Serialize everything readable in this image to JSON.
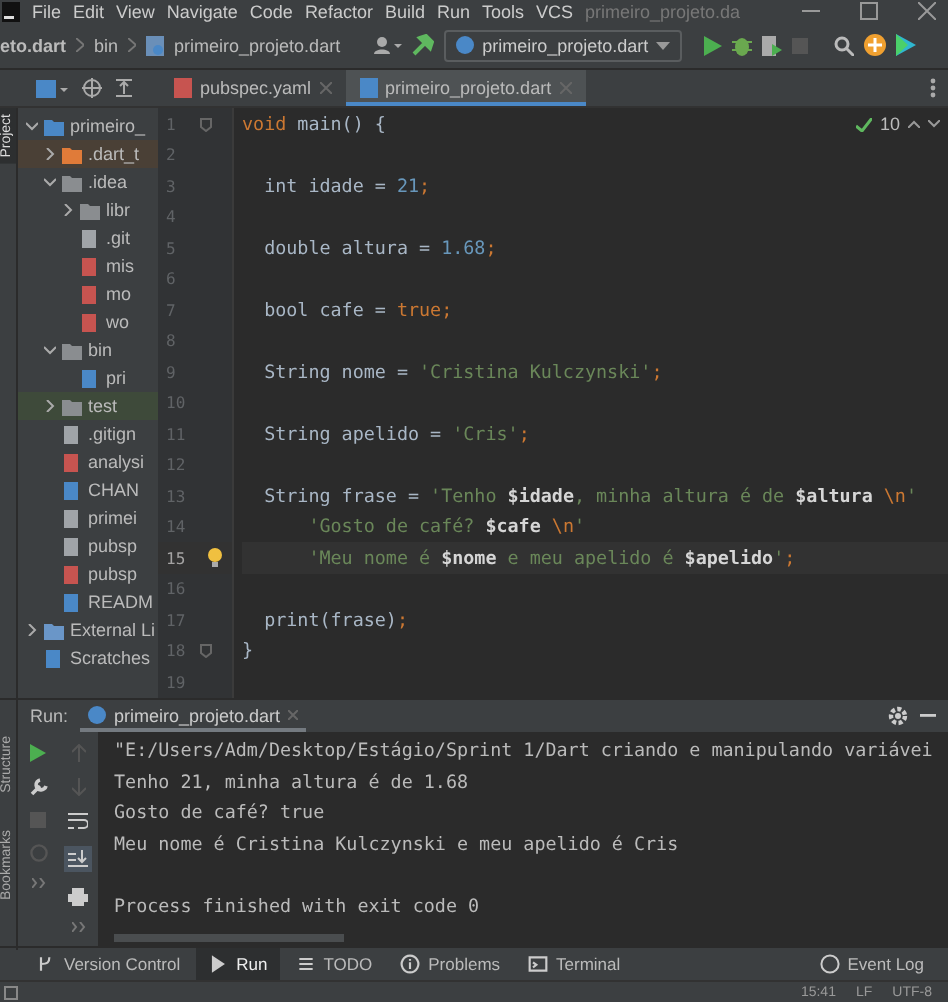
{
  "menu_bar": {
    "items": [
      "File",
      "Edit",
      "View",
      "Navigate",
      "Code",
      "Refactor",
      "Build",
      "Run",
      "Tools",
      "VCS"
    ],
    "title": "primeiro_projeto.da"
  },
  "nav_bar": {
    "breadcrumbs": [
      "eto.dart",
      "bin",
      "primeiro_projeto.dart"
    ],
    "run_config": "primeiro_projeto.dart"
  },
  "editor_tabs": [
    {
      "label": "pubspec.yaml",
      "kind": "yaml",
      "selected": false
    },
    {
      "label": "primeiro_projeto.dart",
      "kind": "dart",
      "selected": true
    }
  ],
  "side_stripe": {
    "top": "Project",
    "bottom": [
      "Structure",
      "Bookmarks"
    ]
  },
  "project_tree": {
    "items": [
      {
        "label": "primeiro_",
        "kind": "project",
        "expanded": true,
        "children": [
          {
            "label": ".dart_t",
            "kind": "excluded",
            "expanded": false
          },
          {
            "label": ".idea",
            "kind": "folder",
            "expanded": true,
            "children": [
              {
                "label": "libr",
                "kind": "folder",
                "expanded": false
              },
              {
                "label": ".git",
                "kind": "file"
              },
              {
                "label": "mis",
                "kind": "xml"
              },
              {
                "label": "mo",
                "kind": "xml"
              },
              {
                "label": "wo",
                "kind": "xml"
              }
            ]
          },
          {
            "label": "bin",
            "kind": "folder",
            "expanded": true,
            "children": [
              {
                "label": "pri",
                "kind": "dart"
              }
            ]
          },
          {
            "label": "test",
            "kind": "test",
            "expanded": false
          },
          {
            "label": ".gitign",
            "kind": "file"
          },
          {
            "label": "analysi",
            "kind": "yaml"
          },
          {
            "label": "CHAN",
            "kind": "md"
          },
          {
            "label": "primei",
            "kind": "file"
          },
          {
            "label": "pubsp",
            "kind": "file"
          },
          {
            "label": "pubsp",
            "kind": "yaml"
          },
          {
            "label": "READM",
            "kind": "md"
          }
        ]
      },
      {
        "label": "External Li",
        "kind": "library",
        "expanded": false
      },
      {
        "label": "Scratches",
        "kind": "scratch"
      }
    ]
  },
  "editor": {
    "inspections": "10",
    "lines": [
      {
        "number": "1",
        "fold": true,
        "tokens": [
          {
            "kind": "kw",
            "text": "void"
          },
          {
            "kind": "plain",
            "text": " main() {"
          }
        ]
      },
      {
        "number": "2"
      },
      {
        "number": "3",
        "tokens": [
          {
            "kind": "plain",
            "text": "  int idade = "
          },
          {
            "kind": "num",
            "text": "21"
          },
          {
            "kind": "kw",
            "text": ";"
          }
        ]
      },
      {
        "number": "4"
      },
      {
        "number": "5",
        "tokens": [
          {
            "kind": "plain",
            "text": "  double altura = "
          },
          {
            "kind": "num",
            "text": "1.68"
          },
          {
            "kind": "kw",
            "text": ";"
          }
        ]
      },
      {
        "number": "6"
      },
      {
        "number": "7",
        "tokens": [
          {
            "kind": "plain",
            "text": "  bool cafe = "
          },
          {
            "kind": "kw",
            "text": "true;"
          }
        ]
      },
      {
        "number": "8"
      },
      {
        "number": "9",
        "tokens": [
          {
            "kind": "plain",
            "text": "  String nome = "
          },
          {
            "kind": "str",
            "text": "'Cristina Kulczynski'"
          },
          {
            "kind": "kw",
            "text": ";"
          }
        ]
      },
      {
        "number": "10"
      },
      {
        "number": "11",
        "tokens": [
          {
            "kind": "plain",
            "text": "  String apelido = "
          },
          {
            "kind": "str",
            "text": "'Cris'"
          },
          {
            "kind": "kw",
            "text": ";"
          }
        ]
      },
      {
        "number": "12"
      },
      {
        "number": "13",
        "tokens": [
          {
            "kind": "plain",
            "text": "  String frase = "
          },
          {
            "kind": "str",
            "text": "'Tenho "
          },
          {
            "kind": "var",
            "text": "$idade"
          },
          {
            "kind": "str",
            "text": ", minha altura é de "
          },
          {
            "kind": "var",
            "text": "$altura"
          },
          {
            "kind": "kw",
            "text": " \\n"
          },
          {
            "kind": "str",
            "text": "'"
          }
        ]
      },
      {
        "number": "14",
        "tokens": [
          {
            "kind": "str",
            "text": "      'Gosto de café? "
          },
          {
            "kind": "var",
            "text": "$cafe"
          },
          {
            "kind": "kw",
            "text": " \\n"
          },
          {
            "kind": "str",
            "text": "'"
          }
        ]
      },
      {
        "number": "15",
        "current": true,
        "bulb": true,
        "tokens": [
          {
            "kind": "str",
            "text": "      'Meu nome é "
          },
          {
            "kind": "var",
            "text": "$nome"
          },
          {
            "kind": "str",
            "text": " e meu apelido é "
          },
          {
            "kind": "var",
            "text": "$apelido"
          },
          {
            "kind": "str",
            "text": "'"
          },
          {
            "kind": "kw",
            "text": ";"
          }
        ]
      },
      {
        "number": "16"
      },
      {
        "number": "17",
        "tokens": [
          {
            "kind": "plain",
            "text": "  print(frase)"
          },
          {
            "kind": "kw",
            "text": ";"
          }
        ]
      },
      {
        "number": "18",
        "fold": true,
        "tokens": [
          {
            "kind": "plain",
            "text": "}"
          }
        ]
      },
      {
        "number": "19"
      }
    ]
  },
  "run_panel": {
    "label": "Run:",
    "tab": "primeiro_projeto.dart",
    "console": [
      {
        "kind": "command",
        "text": "\"E:/Users/Adm/Desktop/Estágio/Sprint 1/Dart criando e manipulando variávei"
      },
      {
        "kind": "output",
        "text": "Tenho 21, minha altura é de 1.68"
      },
      {
        "kind": "output",
        "text": "Gosto de café? true"
      },
      {
        "kind": "output",
        "text": "Meu nome é Cristina Kulczynski e meu apelido é Cris"
      },
      {
        "kind": "status",
        "text": "Process finished with exit code 0"
      }
    ]
  },
  "tool_buttons": [
    {
      "label": "Version Control",
      "kind": "branch",
      "selected": false
    },
    {
      "label": "Run",
      "kind": "run",
      "selected": true
    },
    {
      "label": "TODO",
      "kind": "list",
      "selected": false
    },
    {
      "label": "Problems",
      "kind": "info",
      "selected": false
    },
    {
      "label": "Terminal",
      "kind": "terminal",
      "selected": false
    }
  ],
  "event_log": "Event Log",
  "status_bar": [
    "15:41",
    "LF",
    "UTF-8"
  ]
}
